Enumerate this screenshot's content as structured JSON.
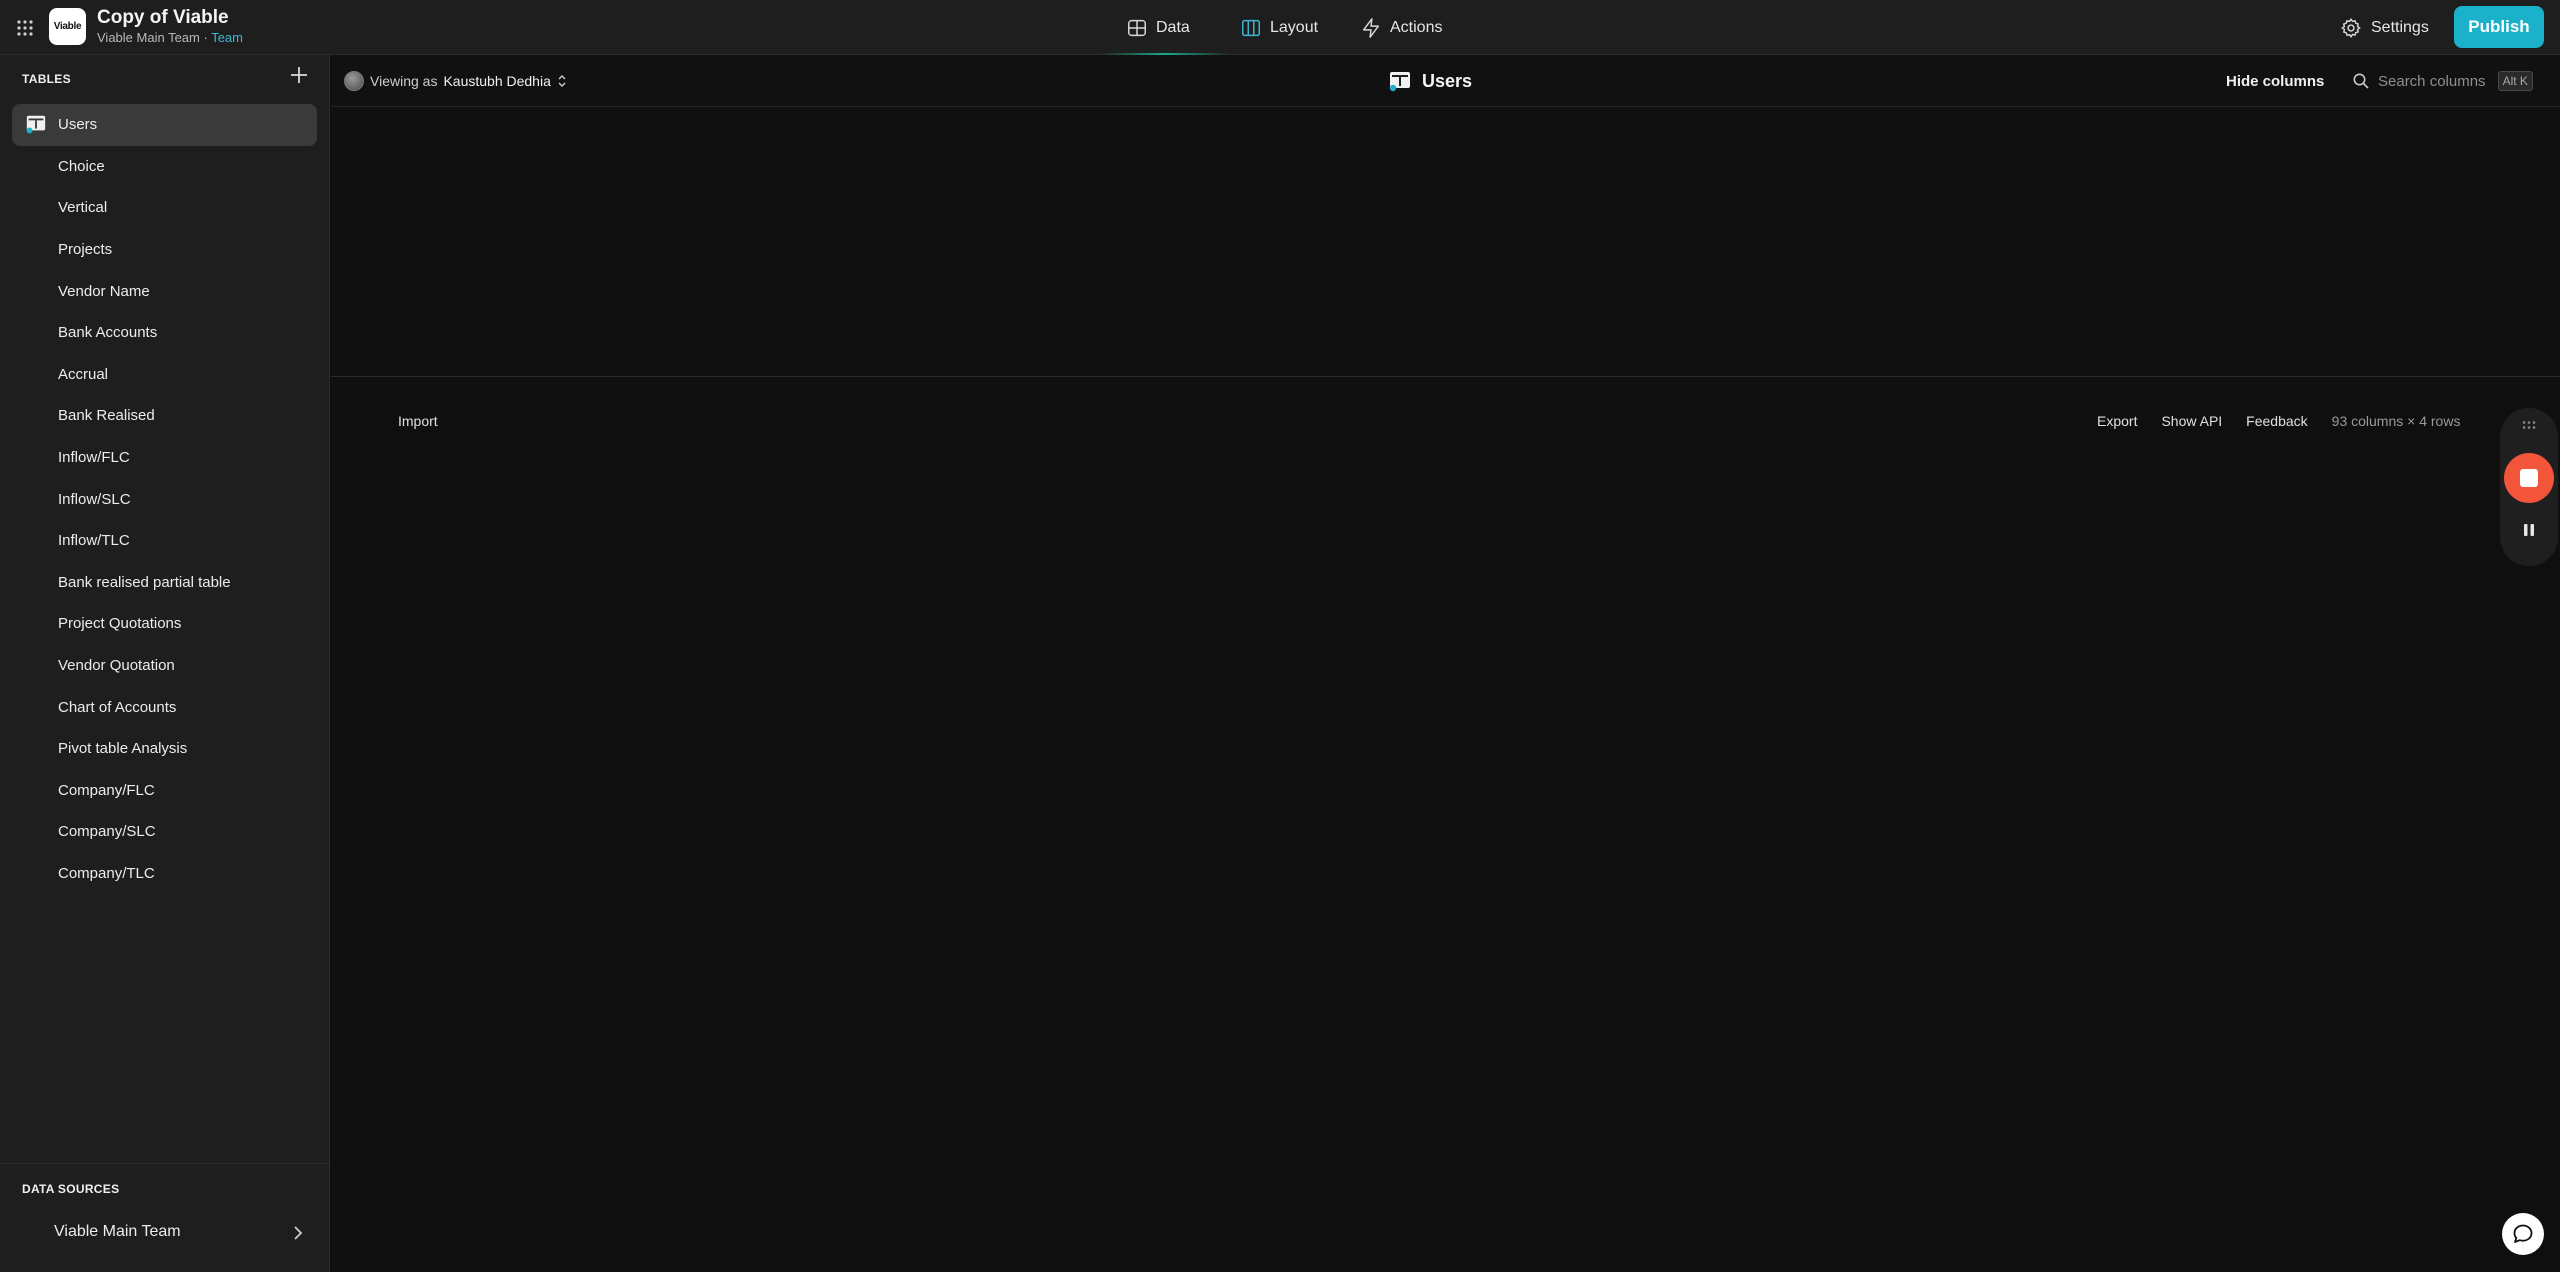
{
  "app": {
    "title": "Copy of Viable",
    "logo_text": "Viable",
    "workspace": "Viable Main Team",
    "separator": " · ",
    "plan": "Team"
  },
  "nav": {
    "data": "Data",
    "layout": "Layout",
    "actions": "Actions",
    "settings": "Settings",
    "publish": "Publish"
  },
  "sidebar": {
    "tables_title": "TABLES",
    "tables": [
      {
        "label": "Users",
        "active": true
      },
      {
        "label": "Choice"
      },
      {
        "label": "Vertical"
      },
      {
        "label": "Projects"
      },
      {
        "label": "Vendor Name"
      },
      {
        "label": "Bank Accounts"
      },
      {
        "label": "Accrual"
      },
      {
        "label": "Bank Realised"
      },
      {
        "label": "Inflow/FLC"
      },
      {
        "label": "Inflow/SLC"
      },
      {
        "label": "Inflow/TLC"
      },
      {
        "label": "Bank realised partial table"
      },
      {
        "label": "Project Quotations"
      },
      {
        "label": "Vendor Quotation"
      },
      {
        "label": "Chart of Accounts"
      },
      {
        "label": "Pivot table Analysis"
      },
      {
        "label": "Company/FLC"
      },
      {
        "label": "Company/SLC"
      },
      {
        "label": "Company/TLC"
      }
    ],
    "data_sources_title": "DATA SOURCES",
    "data_source": "Viable Main Team"
  },
  "header": {
    "viewing_prefix": "Viewing as",
    "viewing_user": "Kaustubh Dedhia",
    "table_title": "Users",
    "hide_columns": "Hide columns",
    "search_placeholder": "Search columns",
    "search_shortcut": "Alt K"
  },
  "footer": {
    "import": "Import",
    "export": "Export",
    "show_api": "Show API",
    "feedback": "Feedback",
    "count": "93 columns × 4 rows"
  },
  "colors": {
    "accent": "#1bb1cb",
    "record": "#f2553a",
    "team": "#3fb6d2"
  }
}
